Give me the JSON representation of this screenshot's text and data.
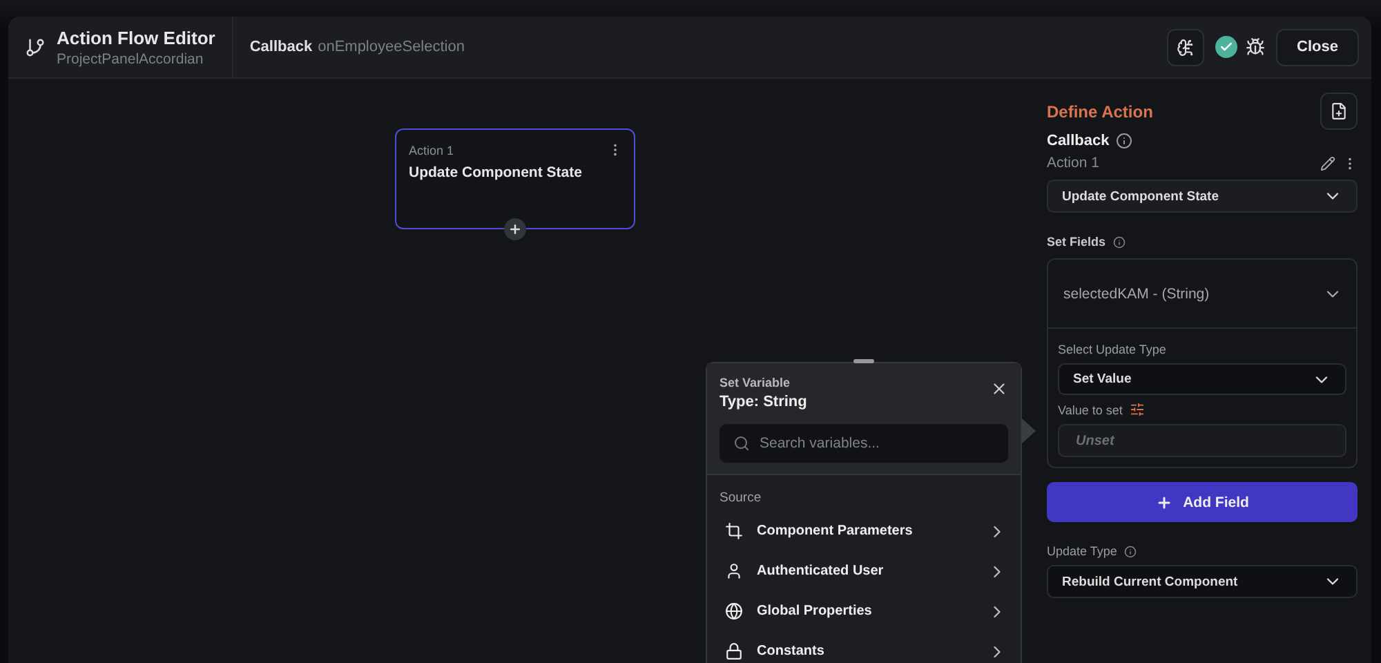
{
  "header": {
    "title": "Action Flow Editor",
    "subtitle": "ProjectPanelAccordian",
    "callback_label": "Callback",
    "callback_name": "onEmployeeSelection",
    "valid": true,
    "close": "Close"
  },
  "canvas": {
    "nodes": [
      {
        "label": "Action 1",
        "title": "Update Component State",
        "selected": true
      }
    ]
  },
  "popup": {
    "label": "Set Variable",
    "title": "Type: String",
    "search": {
      "placeholder": "Search variables..."
    },
    "section": "Source",
    "items": [
      {
        "kind": "params",
        "label": "Component Parameters"
      },
      {
        "kind": "user",
        "label": "Authenticated User"
      },
      {
        "kind": "global",
        "label": "Global Properties"
      },
      {
        "kind": "constants",
        "label": "Constants"
      }
    ]
  },
  "panel": {
    "title": "Define Action",
    "callback": "Callback",
    "action_name": "Action 1",
    "action_type": "Update Component State",
    "set_fields_label": "Set Fields",
    "field": {
      "name": "selectedKAM - (String)",
      "update_type_label": "Select Update Type",
      "update_type": "Set Value",
      "value_label": "Value to set",
      "value_placeholder": "Unset"
    },
    "add_field": "Add Field",
    "update_type_label": "Update Type",
    "update_type": "Rebuild Current Component"
  }
}
